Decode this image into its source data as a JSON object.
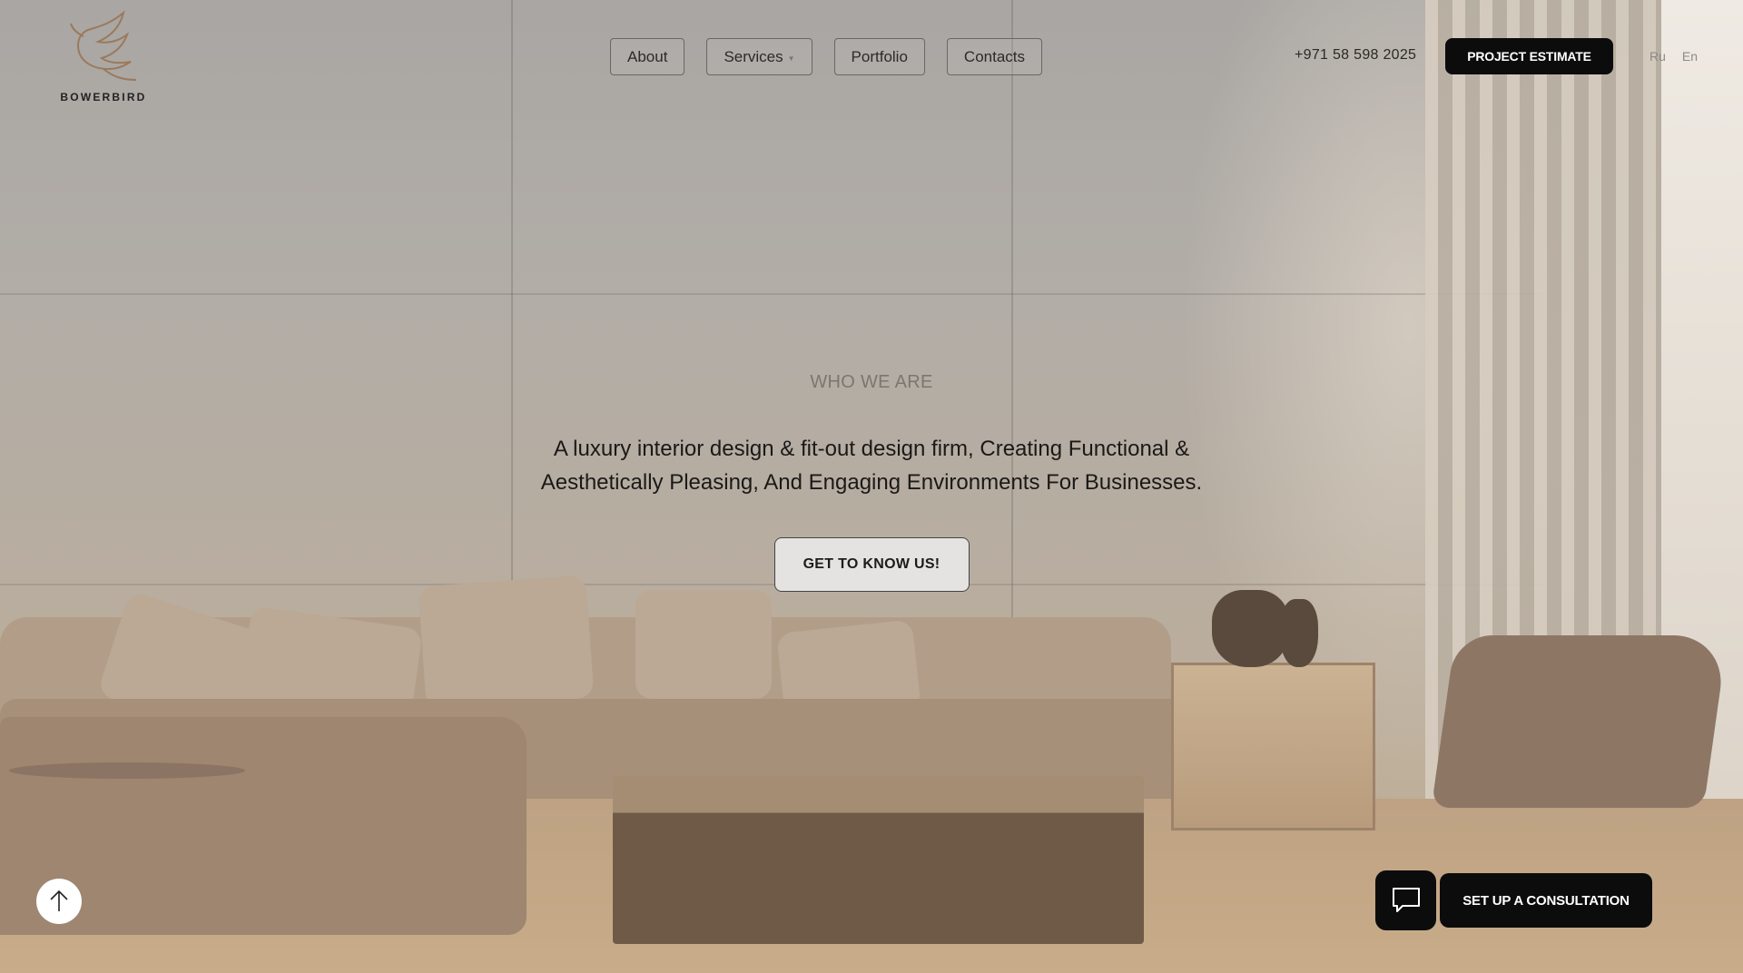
{
  "brand": {
    "name": "BOWERBIRD"
  },
  "nav": {
    "items": [
      {
        "label": "About"
      },
      {
        "label": "Services",
        "has_dropdown": true
      },
      {
        "label": "Portfolio"
      },
      {
        "label": "Contacts"
      }
    ]
  },
  "header": {
    "phone": "+971 58 598 2025",
    "estimate_label": "PROJECT ESTIMATE",
    "languages": [
      "Ru",
      "En"
    ]
  },
  "hero": {
    "eyebrow": "WHO WE ARE",
    "headline": "A luxury interior design & fit-out design firm, Creating Functional & Aesthetically Pleasing, And Engaging Environments For Businesses.",
    "cta_label": "GET TO KNOW US!"
  },
  "floating": {
    "scroll_top_icon": "arrow-up-icon",
    "chat_icon": "chat-bubble-icon",
    "consult_label": "SET UP A CONSULTATION"
  },
  "colors": {
    "primary_button": "#0c0c0c",
    "text_dark": "#1b1917",
    "logo_accent": "#9a7a5c"
  }
}
